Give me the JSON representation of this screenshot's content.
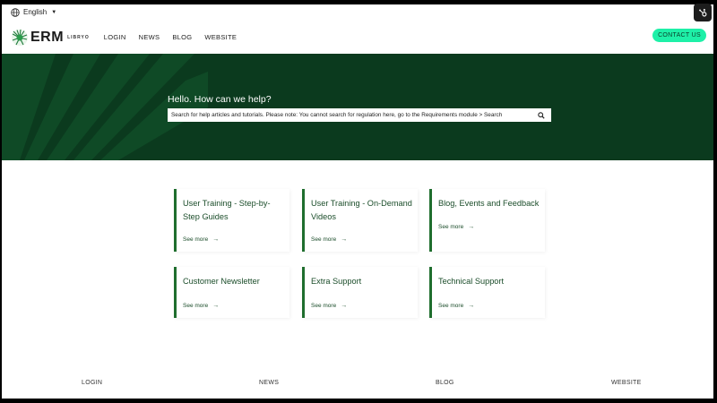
{
  "language": {
    "label": "English"
  },
  "header": {
    "logo_main": "ERM",
    "logo_sub": "LIBRYO",
    "nav": [
      "LOGIN",
      "NEWS",
      "BLOG",
      "WEBSITE"
    ],
    "contact_label": "CONTACT US"
  },
  "hero": {
    "title": "Hello. How can we help?",
    "search_placeholder": "Search for help articles and tutorials. Please note: You cannot search for regulation here, go to the Requirements module > Search"
  },
  "cards": [
    {
      "title": "User Training - Step-by-Step Guides",
      "link": "See more"
    },
    {
      "title": "User Training - On-Demand Videos",
      "link": "See more"
    },
    {
      "title": "Blog, Events and Feedback",
      "link": "See more"
    },
    {
      "title": "Customer Newsletter",
      "link": "See more"
    },
    {
      "title": "Extra Support",
      "link": "See more"
    },
    {
      "title": "Technical Support",
      "link": "See more"
    }
  ],
  "footer": {
    "links": [
      "LOGIN",
      "NEWS",
      "BLOG",
      "WEBSITE"
    ]
  },
  "colors": {
    "hero_bg": "#0b3a1e",
    "contact_bg": "#1ef0a8",
    "card_accent": "#1f6e2e",
    "card_text": "#1b4d2a"
  }
}
